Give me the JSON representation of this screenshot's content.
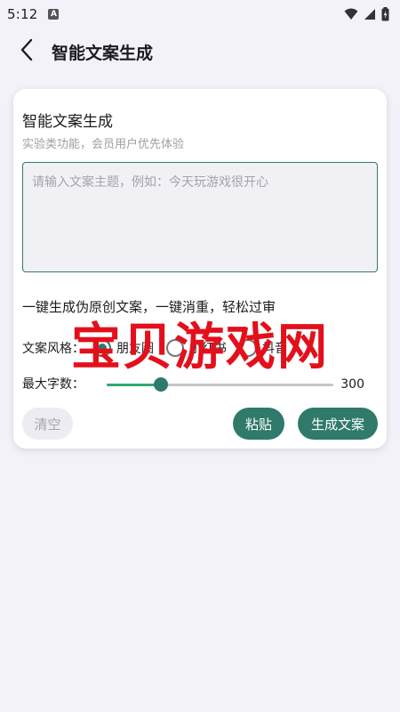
{
  "status_bar": {
    "time": "5:12",
    "notification_icon": "A",
    "icons": [
      "wifi-icon",
      "signal-icon",
      "battery-icon"
    ]
  },
  "app_bar": {
    "back_icon": "chevron-left-icon",
    "title": "智能文案生成"
  },
  "card": {
    "title": "智能文案生成",
    "subtitle": "实验类功能，会员用户优先体验",
    "input": {
      "value": "",
      "placeholder": "请输入文案主题，例如：今天玩游戏很开心"
    },
    "slogan": "一键生成伪原创文案，一键消重，轻松过审",
    "style": {
      "label": "文案风格：",
      "options": [
        {
          "label": "朋友圈",
          "selected": true
        },
        {
          "label": "小红书",
          "selected": false
        },
        {
          "label": "抖音",
          "selected": false
        }
      ]
    },
    "length": {
      "label": "最大字数：",
      "value": "300",
      "fraction": 0.24
    },
    "buttons": {
      "clear": "清空",
      "paste": "粘贴",
      "generate": "生成文案"
    }
  },
  "watermark": "宝贝游戏网",
  "colors": {
    "primary": "#2f7a6a",
    "slider_active": "#2eaa6e",
    "watermark": "#e3101c",
    "background": "#f3f2f8"
  }
}
